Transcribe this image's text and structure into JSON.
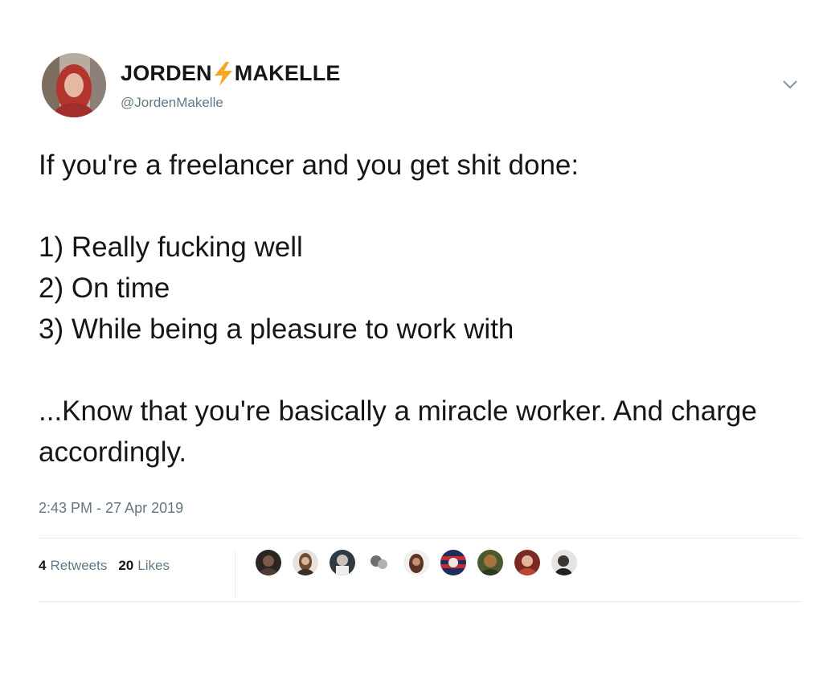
{
  "user": {
    "display_name_first": "JORDEN",
    "display_name_last": "MAKELLE",
    "name_separator_icon": "lightning-bolt-icon",
    "handle": "@JordenMakelle",
    "avatar_icon": "profile-photo"
  },
  "menu": {
    "caret_icon": "chevron-down-icon"
  },
  "tweet": {
    "intro": "If you're a freelancer and you get shit done:",
    "list": [
      "1) Really fucking well",
      "2) On time",
      "3) While being a pleasure to work with"
    ],
    "conclusion": "...Know that you're basically a miracle worker. And charge accordingly."
  },
  "meta": {
    "timestamp": "2:43 PM - 27 Apr 2019"
  },
  "stats": {
    "retweets_count": "4",
    "retweets_label": "Retweets",
    "likes_count": "20",
    "likes_label": "Likes"
  },
  "colors": {
    "text": "#14171a",
    "secondary": "#657786",
    "divider": "#e6ecf0",
    "bolt": "#f5a623"
  }
}
